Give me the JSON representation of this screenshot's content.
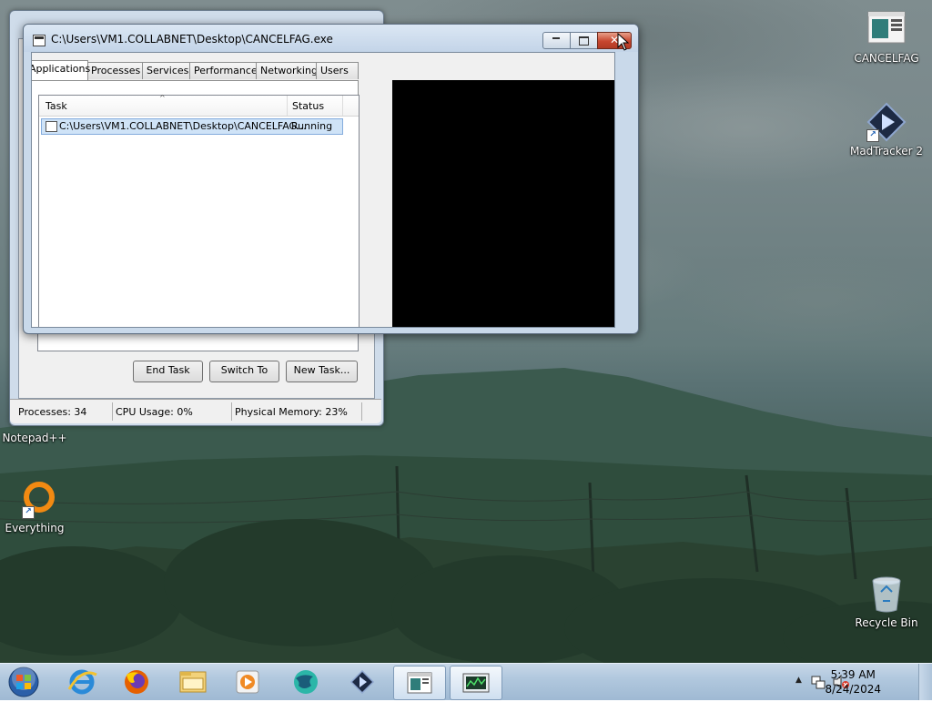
{
  "desktop": {
    "icons": [
      {
        "label": "CANCELFAG",
        "icon": "cancelfag-app-icon"
      },
      {
        "label": "MadTracker 2",
        "icon": "madtracker-icon"
      },
      {
        "label": "Notepad++",
        "icon": "notepadpp-icon"
      },
      {
        "label": "Everything",
        "icon": "everything-search-icon"
      },
      {
        "label": "Recycle Bin",
        "icon": "recycle-bin-icon"
      }
    ]
  },
  "task_manager": {
    "tabs": [
      "Applications",
      "Processes",
      "Services",
      "Performance",
      "Networking",
      "Users"
    ],
    "columns": [
      "Task",
      "Status"
    ],
    "rows": [
      {
        "task": "C:\\Users\\VM1.COLLABNET\\Desktop\\CANCELFAG...",
        "status": "Running"
      }
    ],
    "buttons": {
      "end_task": "End Task",
      "switch_to": "Switch To",
      "new_task": "New Task..."
    },
    "status_bar": {
      "processes": "Processes: 34",
      "cpu": "CPU Usage: 0%",
      "memory": "Physical Memory: 23%"
    }
  },
  "console_window": {
    "title": "C:\\Users\\VM1.COLLABNET\\Desktop\\CANCELFAG.exe",
    "background": "#000000"
  },
  "taskbar": {
    "pinned": [
      "start-orb-icon",
      "internet-explorer-icon",
      "firefox-icon",
      "file-explorer-icon",
      "media-player-icon",
      "browser-globe-icon",
      "madtracker-icon",
      "cancelfag-window-icon",
      "task-manager-icon"
    ],
    "clock": {
      "time": "5:39 AM",
      "date": "8/24/2024"
    }
  }
}
